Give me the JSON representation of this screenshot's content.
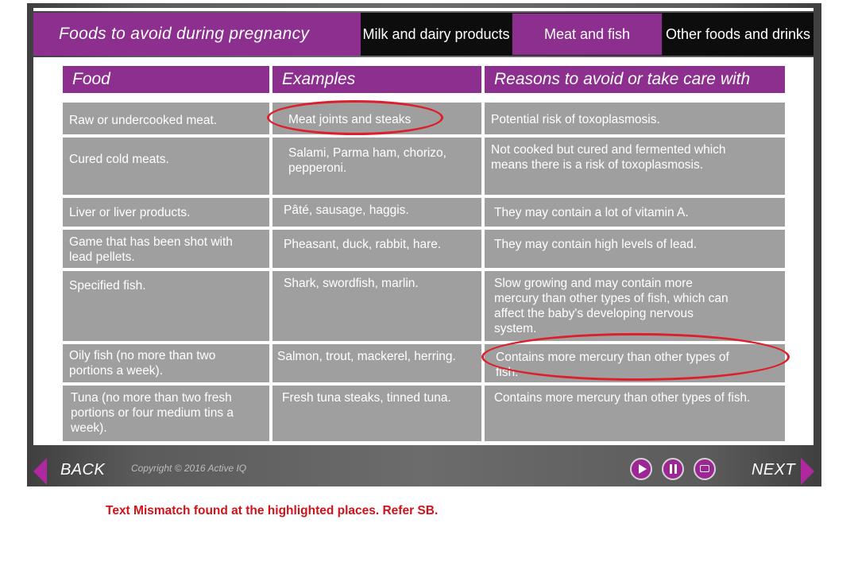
{
  "header": {
    "title": "Foods to avoid during pregnancy",
    "tabs": [
      {
        "label": "Milk and dairy products"
      },
      {
        "label": "Meat and fish"
      },
      {
        "label": "Other foods and drinks"
      }
    ],
    "active_tab": "Meat and fish"
  },
  "table": {
    "headers": [
      "Food",
      "Examples",
      "Reasons to avoid or take care with"
    ],
    "rows": [
      {
        "food": "Raw or undercooked meat.",
        "examples": "Meat joints and steaks",
        "reason": "Potential risk of toxoplasmosis."
      },
      {
        "food": "Cured cold meats.",
        "examples": "Salami, Parma ham, chorizo, pepperoni.",
        "reason": "Not cooked but cured and fermented which means there is a risk of toxoplasmosis."
      },
      {
        "food": "Liver or liver products.",
        "examples": "Pâté, sausage, haggis.",
        "reason": "They may contain a lot of vitamin A."
      },
      {
        "food": "Game that has been shot with lead pellets.",
        "examples": "Pheasant, duck, rabbit, hare.",
        "reason": "They may contain high levels of lead."
      },
      {
        "food": "Specified fish.",
        "examples": "Shark, swordfish, marlin.",
        "reason": "Slow growing and may contain more mercury than other types of fish, which can affect the baby's developing nervous system."
      },
      {
        "food": "Oily fish (no more than two portions a week).",
        "examples": "Salmon, trout, mackerel, herring.",
        "reason": "Contains more mercury than other types of fish."
      },
      {
        "food": "Tuna (no more than two fresh portions or four medium tins a week).",
        "examples": "Fresh tuna steaks, tinned tuna.",
        "reason": "Contains more mercury than other types of fish."
      }
    ]
  },
  "footer": {
    "back_label": "BACK",
    "next_label": "NEXT",
    "copyright": "Copyright © 2016 Active IQ"
  },
  "note": "Text Mismatch found at the highlighted places. Refer SB.",
  "colors": {
    "accent": "#8c2f8f",
    "cell": "#9f9f9f",
    "annotation": "#dd1f2b"
  }
}
